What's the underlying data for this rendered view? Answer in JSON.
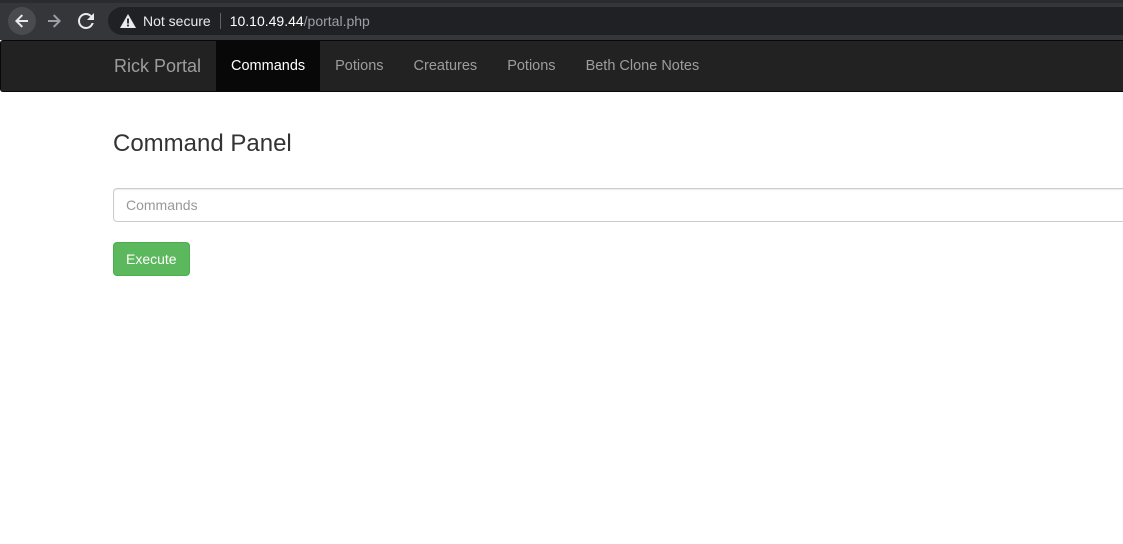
{
  "browser": {
    "security_label": "Not secure",
    "url_host": "10.10.49.44",
    "url_path": "/portal.php",
    "icons": {
      "back": "back-arrow-icon",
      "forward": "forward-arrow-icon",
      "reload": "reload-icon",
      "security": "warning-triangle-icon"
    }
  },
  "navbar": {
    "brand": "Rick Portal",
    "links": [
      {
        "label": "Commands",
        "active": true
      },
      {
        "label": "Potions",
        "active": false
      },
      {
        "label": "Creatures",
        "active": false
      },
      {
        "label": "Potions",
        "active": false
      },
      {
        "label": "Beth Clone Notes",
        "active": false
      }
    ]
  },
  "main": {
    "title": "Command Panel",
    "input": {
      "value": "",
      "placeholder": "Commands"
    },
    "execute_label": "Execute"
  },
  "colors": {
    "chrome_bar": "#35363a",
    "omnibox": "#202124",
    "navbar": "#222222",
    "navbar_active": "#080808",
    "nav_text": "#9d9d9d",
    "title_text": "#333333",
    "success_button": "#5cb85c"
  }
}
